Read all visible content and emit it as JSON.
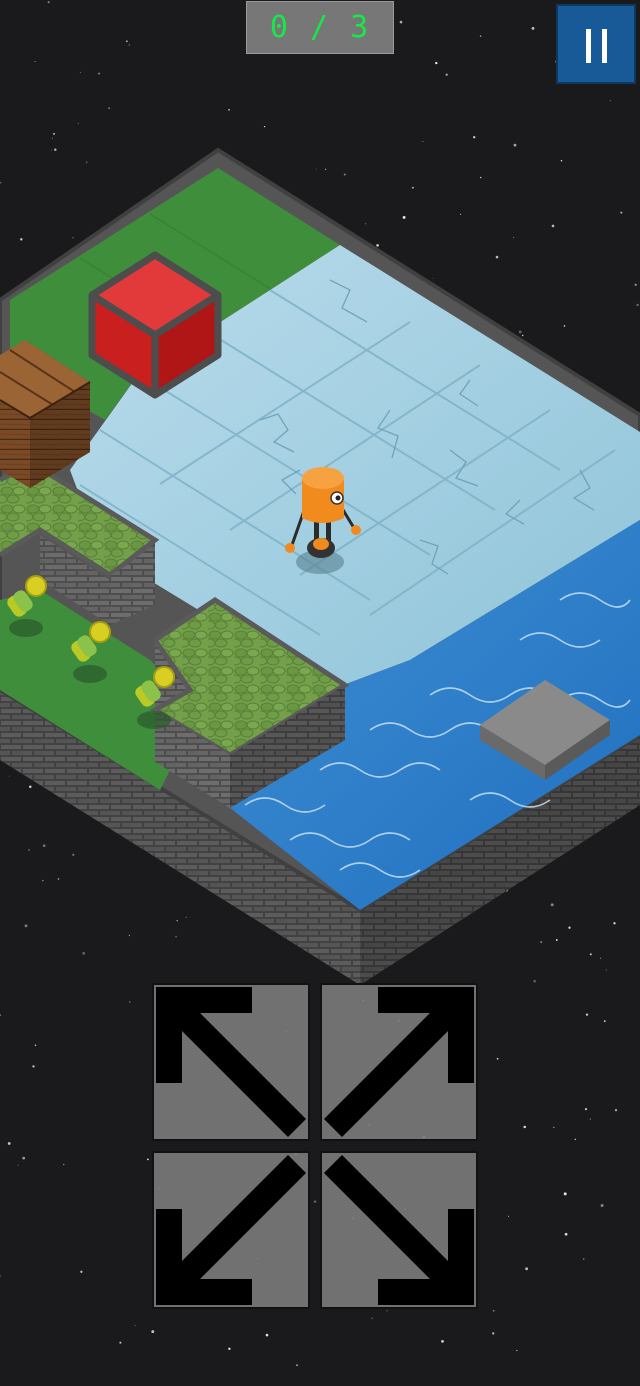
{
  "hud": {
    "collected_counter": "0 / 3",
    "counter_color": "#17e84a",
    "pause_icon": "pause-icon",
    "pause_button_color": "#175a97"
  },
  "controls": {
    "buttons": [
      {
        "name": "move-up-left-button",
        "icon": "arrow-up-left-icon"
      },
      {
        "name": "move-up-right-button",
        "icon": "arrow-up-right-icon"
      },
      {
        "name": "move-down-left-button",
        "icon": "arrow-down-left-icon"
      },
      {
        "name": "move-down-right-button",
        "icon": "arrow-down-right-icon"
      }
    ]
  },
  "scene": {
    "background": "starfield",
    "player": "orange-robot",
    "collectibles": 3,
    "objects": [
      "red-cube",
      "wooden-crate",
      "stone-platform",
      "water-channel"
    ]
  }
}
